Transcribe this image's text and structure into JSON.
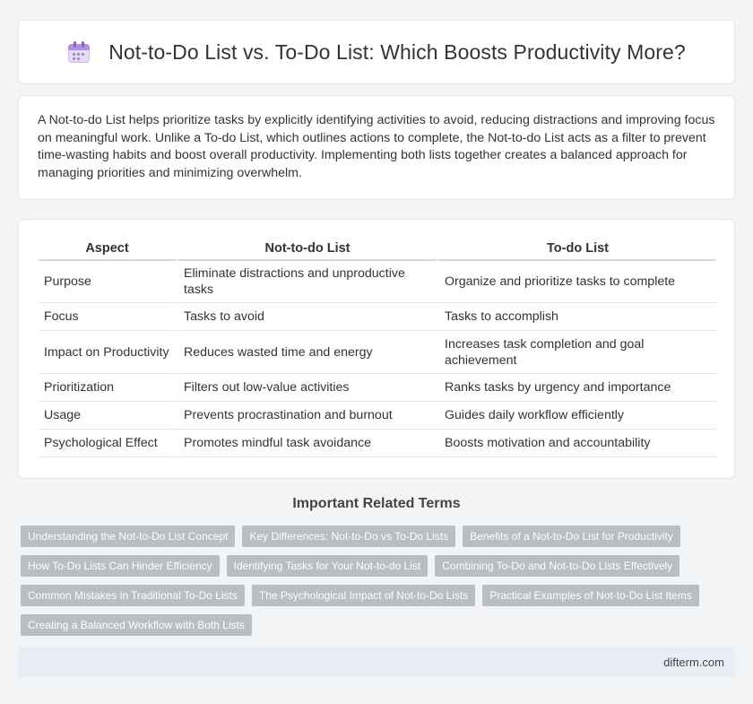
{
  "header": {
    "title": "Not-to-Do List vs. To-Do List: Which Boosts Productivity More?",
    "icon": "calendar-icon"
  },
  "intro": {
    "text": "A Not-to-do List helps prioritize tasks by explicitly identifying activities to avoid, reducing distractions and improving focus on meaningful work. Unlike a To-do List, which outlines actions to complete, the Not-to-do List acts as a filter to prevent time-wasting habits and boost overall productivity. Implementing both lists together creates a balanced approach for managing priorities and minimizing overwhelm."
  },
  "table": {
    "headers": [
      "Aspect",
      "Not-to-do List",
      "To-do List"
    ],
    "rows": [
      [
        "Purpose",
        "Eliminate distractions and unproductive tasks",
        "Organize and prioritize tasks to complete"
      ],
      [
        "Focus",
        "Tasks to avoid",
        "Tasks to accomplish"
      ],
      [
        "Impact on Productivity",
        "Reduces wasted time and energy",
        "Increases task completion and goal achievement"
      ],
      [
        "Prioritization",
        "Filters out low-value activities",
        "Ranks tasks by urgency and importance"
      ],
      [
        "Usage",
        "Prevents procrastination and burnout",
        "Guides daily workflow efficiently"
      ],
      [
        "Psychological Effect",
        "Promotes mindful task avoidance",
        "Boosts motivation and accountability"
      ]
    ]
  },
  "related": {
    "title": "Important Related Terms",
    "tags": [
      "Understanding the Not-to-Do List Concept",
      "Key Differences: Not-to-Do vs To-Do Lists",
      "Benefits of a Not-to-Do List for Productivity",
      "How To-Do Lists Can Hinder Efficiency",
      "Identifying Tasks for Your Not-to-do List",
      "Combining To-Do and Not-to-Do Lists Effectively",
      "Common Mistakes in Traditional To-Do Lists",
      "The Psychological Impact of Not-to-Do Lists",
      "Practical Examples of Not-to-Do List Items",
      "Creating a Balanced Workflow with Both Lists"
    ]
  },
  "footer": {
    "site": "difterm.com"
  }
}
